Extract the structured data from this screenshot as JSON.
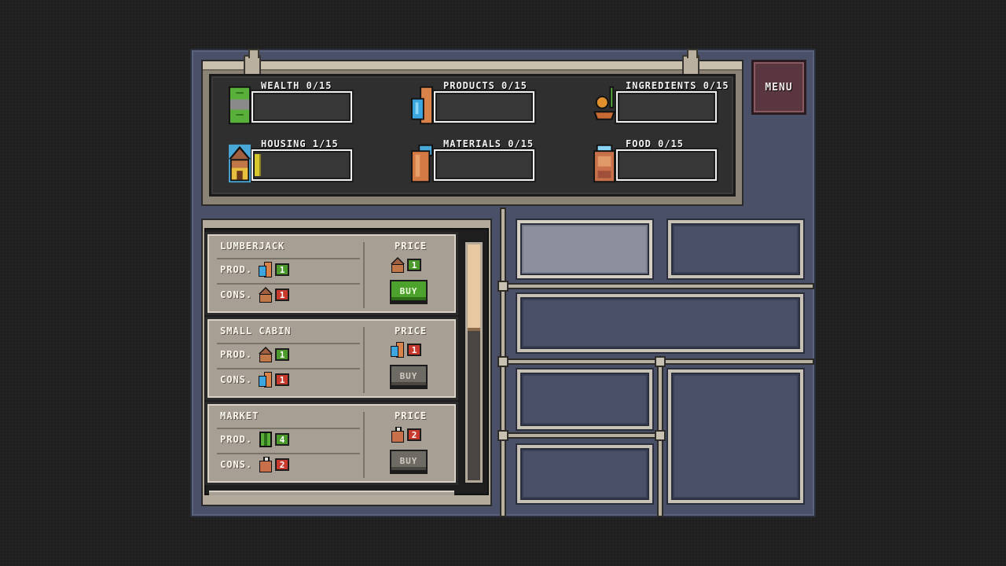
{
  "menu": {
    "label": "MENU"
  },
  "resources": [
    {
      "key": "wealth",
      "label": "WEALTH 0/15",
      "icon": "cash-icon",
      "level": 0
    },
    {
      "key": "products",
      "label": "PRODUCTS 0/15",
      "icon": "product-icon",
      "level": 0
    },
    {
      "key": "ingredients",
      "label": "INGREDIENTS 0/15",
      "icon": "ingredients-icon",
      "level": 0
    },
    {
      "key": "housing",
      "label": "HOUSING 1/15",
      "icon": "house-icon",
      "level": 1
    },
    {
      "key": "materials",
      "label": "MATERIALS 0/15",
      "icon": "log-icon",
      "level": 0
    },
    {
      "key": "food",
      "label": "FOOD 0/15",
      "icon": "food-jar-icon",
      "level": 0
    }
  ],
  "buildings": {
    "prod_label": "PROD.",
    "cons_label": "CONS.",
    "price_label": "PRICE",
    "buy_label": "BUY",
    "items": [
      {
        "name": "LUMBERJACK",
        "prod": {
          "icon": "product-icon",
          "value": "1"
        },
        "cons": {
          "icon": "house-icon",
          "value": "1"
        },
        "price": {
          "icon": "house-icon",
          "value": "1"
        },
        "buy_enabled": true
      },
      {
        "name": "SMALL CABIN",
        "prod": {
          "icon": "house-icon",
          "value": "1"
        },
        "cons": {
          "icon": "product-icon",
          "value": "1"
        },
        "price": {
          "icon": "product-icon",
          "value": "1"
        },
        "buy_enabled": false
      },
      {
        "name": "MARKET",
        "prod": {
          "icon": "cash-icon",
          "value": "4"
        },
        "cons": {
          "icon": "bag-icon",
          "value": "2"
        },
        "price": {
          "icon": "bag-icon",
          "value": "2"
        },
        "buy_enabled": false
      }
    ]
  },
  "colors": {
    "accent_green": "#4ca22c",
    "accent_red": "#c83a2e",
    "panel": "#4a5068",
    "menu": "#5a3640"
  }
}
